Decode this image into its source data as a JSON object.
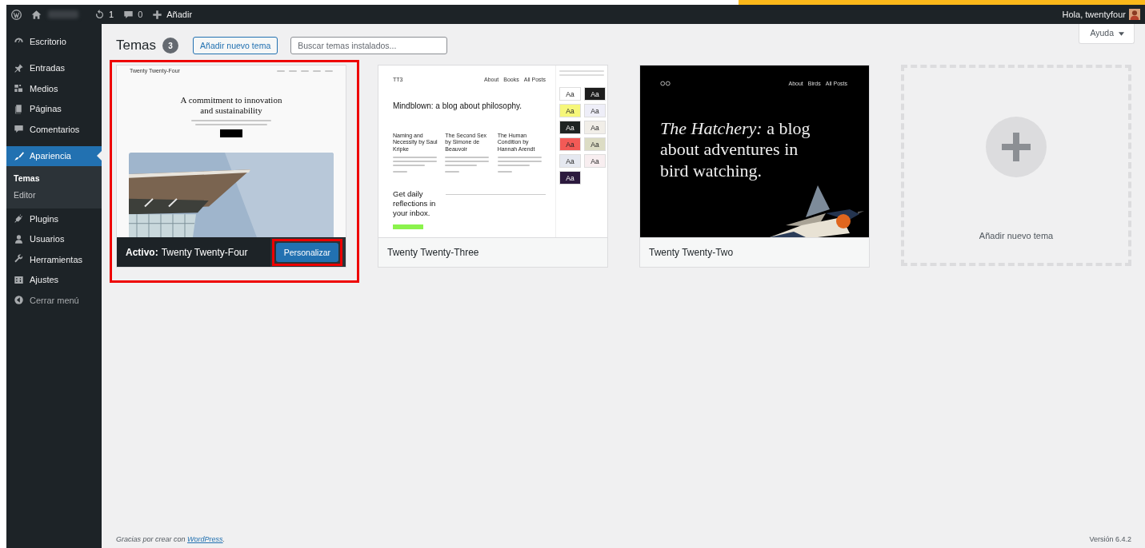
{
  "admin_bar": {
    "updates": "1",
    "comments": "0",
    "new": "Añadir",
    "greeting": "Hola, twentyfour"
  },
  "sidebar": {
    "groups": [
      [
        {
          "label": "Escritorio",
          "selected": false
        }
      ],
      [
        {
          "label": "Entradas",
          "selected": false
        },
        {
          "label": "Medios",
          "selected": false
        },
        {
          "label": "Páginas",
          "selected": false
        },
        {
          "label": "Comentarios",
          "selected": false
        }
      ],
      [
        {
          "label": "Apariencia",
          "selected": true,
          "children": [
            {
              "label": "Temas",
              "selected": true
            },
            {
              "label": "Editor",
              "selected": false
            }
          ]
        },
        {
          "label": "Plugins",
          "selected": false
        },
        {
          "label": "Usuarios",
          "selected": false
        },
        {
          "label": "Herramientas",
          "selected": false
        },
        {
          "label": "Ajustes",
          "selected": false
        }
      ]
    ],
    "collapse": "Cerrar menú"
  },
  "help": "Ayuda",
  "header": {
    "title": "Temas",
    "count": "3",
    "add_button": "Añadir nuevo tema",
    "search": {
      "placeholder": "Buscar temas instalados..."
    }
  },
  "themes": [
    {
      "kind": "theme",
      "name": "Twenty Twenty-Four",
      "active": true,
      "active_label": "Activo:",
      "button": "Personalizar",
      "annotated": true,
      "preview": {
        "kind": "tt4",
        "site": "Twenty Twenty-Four",
        "heading": "A commitment to innovation and sustainability"
      }
    },
    {
      "kind": "theme",
      "name": "Twenty Twenty-Three",
      "active": false,
      "annotated": false,
      "preview": {
        "kind": "tt3",
        "site": "TT3",
        "nav": [
          "About",
          "Books",
          "All Posts"
        ],
        "heading": "Mindblown: a blog about philosophy.",
        "posts": [
          "Naming and Necessity by Saul Kripke",
          "The Second Sex by Simone de Beauvoir",
          "The Human Condition by Hannah Arendt"
        ],
        "cta": "Get daily reflections in your inbox.",
        "tiles": [
          {
            "label": "Aa",
            "color": "#ffffff"
          },
          {
            "label": "Aa",
            "color": "#1d1d1d"
          },
          {
            "label": "Aa",
            "color": "#f6f77a"
          },
          {
            "label": "Aa",
            "color": "#eeeef8"
          },
          {
            "label": "Aa",
            "color": "#1e2422"
          },
          {
            "label": "Aa",
            "color": "#f1eee8"
          },
          {
            "label": "Aa",
            "color": "#f35a56"
          },
          {
            "label": "Aa",
            "color": "#dcdcc4"
          },
          {
            "label": "Aa",
            "color": "#e5e8f0"
          },
          {
            "label": "Aa",
            "color": "#f8eef0"
          },
          {
            "label": "Aa",
            "color": "#2c1a3e"
          }
        ]
      }
    },
    {
      "kind": "theme",
      "name": "Twenty Twenty-Two",
      "active": false,
      "annotated": false,
      "preview": {
        "kind": "tt2",
        "nav": [
          "About",
          "Birds",
          "All Posts"
        ],
        "heading": "*The Hatchery:* a blog about adventures in bird watching."
      }
    },
    {
      "kind": "add",
      "name": "Añadir nuevo tema"
    }
  ],
  "footer": {
    "thanks": "Gracias por crear con",
    "link": "WordPress",
    "suffix": ".",
    "version": "Versión 6.4.2"
  }
}
